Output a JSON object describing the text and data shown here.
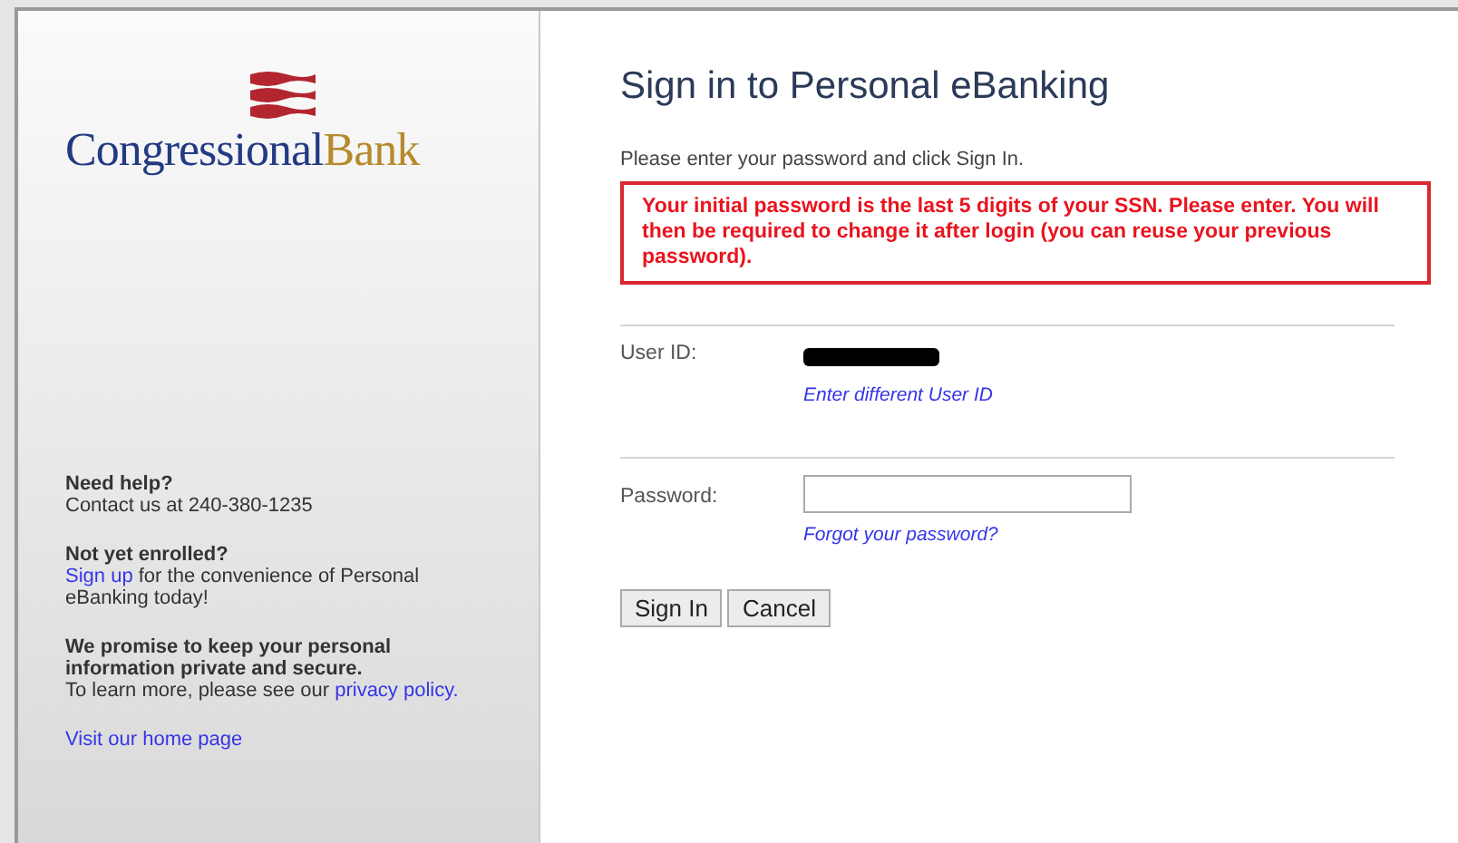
{
  "logo": {
    "name_part_1": "Congressional",
    "name_part_2": "Bank"
  },
  "help": {
    "heading": "Need help?",
    "text": "Contact us at 240-380-1235"
  },
  "enroll": {
    "heading": "Not yet enrolled?",
    "link": "Sign up",
    "text": "for the convenience of Personal eBanking today!"
  },
  "privacy": {
    "heading": "We promise to keep your personal information private and secure.",
    "text": "To learn more, please see our",
    "link": "privacy policy."
  },
  "home_link": "Visit our home page",
  "title": "Sign in to Personal eBanking",
  "instructions": "Please enter your password and click Sign In.",
  "alert": "Your initial password is the last 5 digits of your SSN. Please enter. You will then be required to change it after login (you can reuse your previous password).",
  "user_id": {
    "label": "User ID:",
    "redacted": true,
    "link": "Enter different User ID"
  },
  "password": {
    "label": "Password:",
    "link": "Forgot your password?"
  },
  "buttons": [
    "Sign In",
    "Cancel"
  ]
}
